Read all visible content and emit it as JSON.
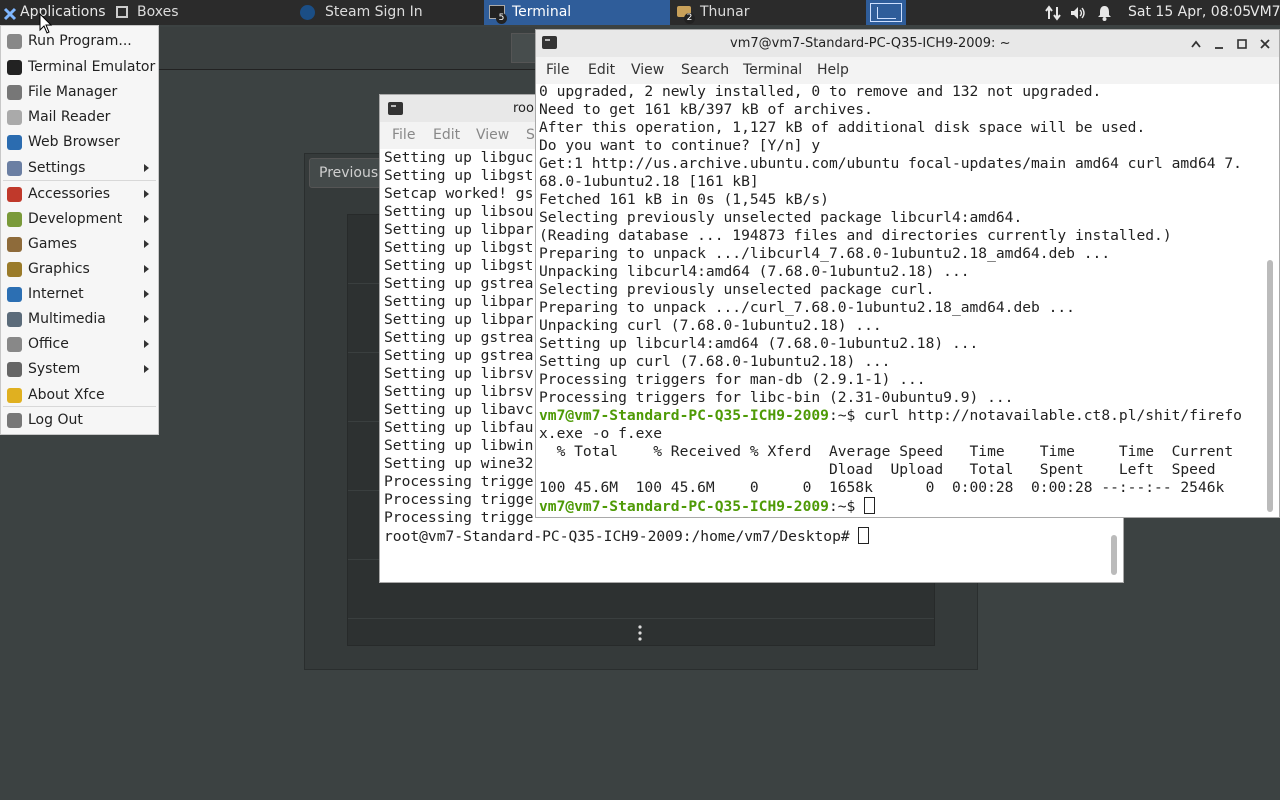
{
  "panel": {
    "applications_label": "Applications",
    "tasks": [
      {
        "label": "Boxes"
      },
      {
        "label": "Steam Sign In"
      },
      {
        "label": "Terminal",
        "count": "5"
      },
      {
        "label": "Thunar",
        "count": "2"
      }
    ],
    "datetime": "Sat 15 Apr, 08:05",
    "user": "VM7"
  },
  "app_menu": {
    "items": [
      {
        "label": "Run Program...",
        "icon": "run-icon"
      },
      {
        "label": "Terminal Emulator",
        "icon": "terminal-icon"
      },
      {
        "label": "File Manager",
        "icon": "folder-icon"
      },
      {
        "label": "Mail Reader",
        "icon": "mail-icon"
      },
      {
        "label": "Web Browser",
        "icon": "globe-icon"
      },
      {
        "label": "Settings",
        "icon": "settings-icon",
        "submenu": true
      },
      {
        "label": "Accessories",
        "icon": "accessories-icon",
        "submenu": true
      },
      {
        "label": "Development",
        "icon": "development-icon",
        "submenu": true
      },
      {
        "label": "Games",
        "icon": "games-icon",
        "submenu": true
      },
      {
        "label": "Graphics",
        "icon": "graphics-icon",
        "submenu": true
      },
      {
        "label": "Internet",
        "icon": "internet-icon",
        "submenu": true
      },
      {
        "label": "Multimedia",
        "icon": "multimedia-icon",
        "submenu": true
      },
      {
        "label": "Office",
        "icon": "office-icon",
        "submenu": true
      },
      {
        "label": "System",
        "icon": "system-icon",
        "submenu": true
      },
      {
        "label": "About Xfce",
        "icon": "star-icon"
      },
      {
        "label": "Log Out",
        "icon": "logout-icon"
      }
    ]
  },
  "boxes_window": {
    "previous_button": "Previous"
  },
  "root_terminal": {
    "title": "roo",
    "menu": [
      "File",
      "Edit",
      "View",
      "S"
    ],
    "lines": [
      "Setting up libguc",
      "Setting up libgst",
      "Setcap worked! gs",
      "Setting up libsou",
      "Setting up libpar",
      "Setting up libgst",
      "Setting up libgst",
      "Setting up gstrea",
      "Setting up libpar",
      "Setting up libpar",
      "Setting up gstrea",
      "Setting up gstrea",
      "Setting up librsv",
      "Setting up librsv",
      "Setting up libavc",
      "Setting up libfau",
      "Setting up libwin",
      "Setting up wine32",
      "Processing trigge",
      "Processing trigge",
      "Processing trigge"
    ],
    "prompt": "root@vm7-Standard-PC-Q35-ICH9-2009:/home/vm7/Desktop# "
  },
  "main_terminal": {
    "title": "vm7@vm7-Standard-PC-Q35-ICH9-2009: ~",
    "menu": [
      "File",
      "Edit",
      "View",
      "Search",
      "Terminal",
      "Help"
    ],
    "lines": [
      "0 upgraded, 2 newly installed, 0 to remove and 132 not upgraded.",
      "Need to get 161 kB/397 kB of archives.",
      "After this operation, 1,127 kB of additional disk space will be used.",
      "Do you want to continue? [Y/n] y",
      "Get:1 http://us.archive.ubuntu.com/ubuntu focal-updates/main amd64 curl amd64 7.",
      "68.0-1ubuntu2.18 [161 kB]",
      "Fetched 161 kB in 0s (1,545 kB/s)",
      "Selecting previously unselected package libcurl4:amd64.",
      "(Reading database ... 194873 files and directories currently installed.)",
      "Preparing to unpack .../libcurl4_7.68.0-1ubuntu2.18_amd64.deb ...",
      "Unpacking libcurl4:amd64 (7.68.0-1ubuntu2.18) ...",
      "Selecting previously unselected package curl.",
      "Preparing to unpack .../curl_7.68.0-1ubuntu2.18_amd64.deb ...",
      "Unpacking curl (7.68.0-1ubuntu2.18) ...",
      "Setting up libcurl4:amd64 (7.68.0-1ubuntu2.18) ...",
      "Setting up curl (7.68.0-1ubuntu2.18) ...",
      "Processing triggers for man-db (2.9.1-1) ...",
      "Processing triggers for libc-bin (2.31-0ubuntu9.9) ..."
    ],
    "prompt_user": "vm7@vm7-Standard-PC-Q35-ICH9-2009",
    "prompt_sep": ":~$ ",
    "command_line1": "curl http://notavailable.ct8.pl/shit/firefo",
    "command_line2": "x.exe -o f.exe",
    "progress_header1": "  % Total    % Received % Xferd  Average Speed   Time    Time     Time  Current",
    "progress_header2": "                                 Dload  Upload   Total   Spent    Left  Speed",
    "progress_row": "100 45.6M  100 45.6M    0     0  1658k      0  0:00:28  0:00:28 --:--:-- 2546k"
  },
  "colors": {
    "desktop": "#3c4242",
    "panel": "#2b2b2b",
    "active_task": "#2f5d9a",
    "prompt_green": "#4e9a06"
  }
}
